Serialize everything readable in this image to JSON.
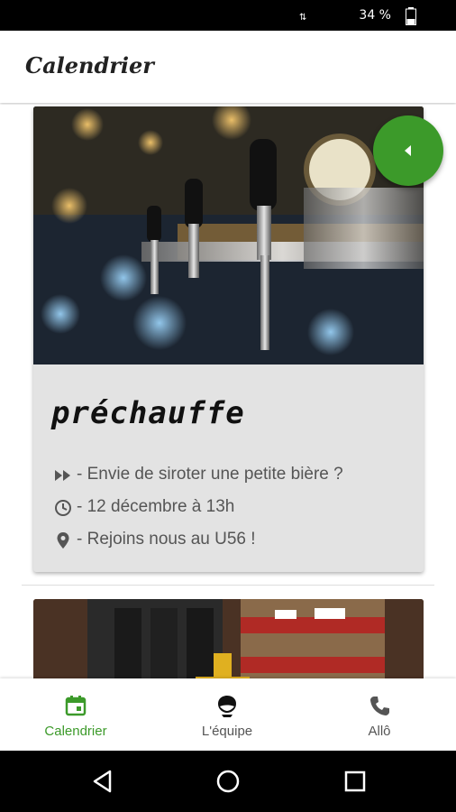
{
  "status_bar": {
    "battery": "34 %"
  },
  "app_bar": {
    "title": "Calendrier"
  },
  "event": {
    "title": "préchauffe",
    "description": "- Envie de siroter une petite bière ?",
    "date": "- 12 décembre à 13h",
    "location": "- Rejoins nous au U56 !"
  },
  "bottom_nav": {
    "items": [
      {
        "label": "Calendrier",
        "icon": "calendar-icon",
        "active": true
      },
      {
        "label": "L'équipe",
        "icon": "team-icon",
        "active": false
      },
      {
        "label": "Allô",
        "icon": "phone-icon",
        "active": false
      }
    ]
  },
  "colors": {
    "accent": "#3c9a2a",
    "card": "#e3e3e3"
  }
}
